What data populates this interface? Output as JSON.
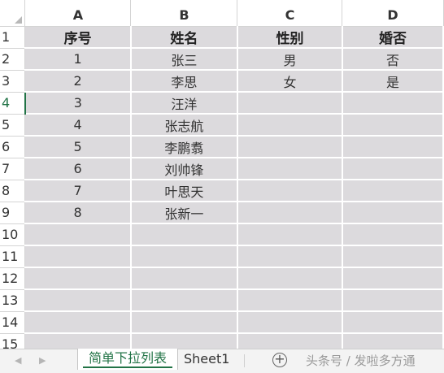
{
  "columns": [
    "A",
    "B",
    "C",
    "D"
  ],
  "row_numbers": [
    "1",
    "2",
    "3",
    "4",
    "5",
    "6",
    "7",
    "8",
    "9",
    "10",
    "11",
    "12",
    "13",
    "14",
    "15"
  ],
  "rows": [
    [
      "序号",
      "姓名",
      "性别",
      "婚否"
    ],
    [
      "1",
      "张三",
      "男",
      "否"
    ],
    [
      "2",
      "李思",
      "女",
      "是"
    ],
    [
      "3",
      "汪洋",
      "",
      ""
    ],
    [
      "4",
      "张志航",
      "",
      ""
    ],
    [
      "5",
      "李鹏翥",
      "",
      ""
    ],
    [
      "6",
      "刘帅锋",
      "",
      ""
    ],
    [
      "7",
      "叶思天",
      "",
      ""
    ],
    [
      "8",
      "张新一",
      "",
      ""
    ],
    [
      "",
      "",
      "",
      ""
    ],
    [
      "",
      "",
      "",
      ""
    ],
    [
      "",
      "",
      "",
      ""
    ],
    [
      "",
      "",
      "",
      ""
    ],
    [
      "",
      "",
      "",
      ""
    ],
    [
      "",
      "",
      "",
      ""
    ]
  ],
  "active_row": "4",
  "tabs": {
    "prev_icon": "◀",
    "next_icon": "▶",
    "active_label": "简单下拉列表",
    "inactive_label": "Sheet1",
    "add_icon": "+"
  },
  "watermark": "头条号 / 发啦多方通",
  "colors": {
    "cell_fill": "#dcdadd",
    "accent": "#217346"
  }
}
